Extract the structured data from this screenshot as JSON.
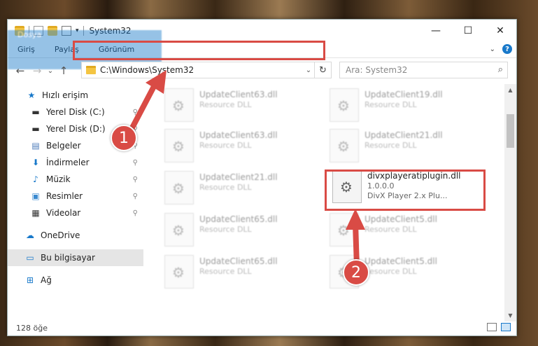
{
  "window": {
    "title": "System32",
    "controls": {
      "minimize": "—",
      "maximize": "☐",
      "close": "✕"
    }
  },
  "ribbon": {
    "tabs": [
      "Dosya",
      "Giriş",
      "Paylaş",
      "Görünüm"
    ]
  },
  "nav": {
    "address": "C:\\Windows\\System32",
    "search_placeholder": "Ara: System32"
  },
  "sidebar": {
    "items": [
      {
        "label": "Hızlı erişim",
        "icon": "star-icon",
        "pinned": false
      },
      {
        "label": "Yerel Disk (C:)",
        "icon": "drive-icon",
        "pinned": true
      },
      {
        "label": "Yerel Disk (D:)",
        "icon": "drive-icon",
        "pinned": true
      },
      {
        "label": "Belgeler",
        "icon": "documents-icon",
        "pinned": true
      },
      {
        "label": "İndirmeler",
        "icon": "download-icon",
        "pinned": true
      },
      {
        "label": "Müzik",
        "icon": "music-icon",
        "pinned": true
      },
      {
        "label": "Resimler",
        "icon": "pictures-icon",
        "pinned": true
      },
      {
        "label": "Videolar",
        "icon": "videos-icon",
        "pinned": true
      },
      {
        "label": "OneDrive",
        "icon": "cloud-icon",
        "pinned": false
      },
      {
        "label": "Bu bilgisayar",
        "icon": "computer-icon",
        "pinned": false,
        "selected": true
      },
      {
        "label": "Ağ",
        "icon": "network-icon",
        "pinned": false
      }
    ]
  },
  "files": [
    {
      "name": "UpdateClient63.dll",
      "sub1": "Resource DLL",
      "sub2": ""
    },
    {
      "name": "UpdateClient19.dll",
      "sub1": "Resource DLL",
      "sub2": ""
    },
    {
      "name": "UpdateClient63.dll",
      "sub1": "Resource DLL",
      "sub2": ""
    },
    {
      "name": "UpdateClient21.dll",
      "sub1": "Resource DLL",
      "sub2": ""
    },
    {
      "name": "UpdateClient21.dll",
      "sub1": "Resource DLL",
      "sub2": ""
    },
    {
      "name": "divxplayeratiplugin.dll",
      "sub1": "1.0.0.0",
      "sub2": "DivX Player 2.x Plu..."
    },
    {
      "name": "UpdateClient65.dll",
      "sub1": "Resource DLL",
      "sub2": ""
    },
    {
      "name": "UpdateClient5.dll",
      "sub1": "Resource DLL",
      "sub2": ""
    },
    {
      "name": "UpdateClient65.dll",
      "sub1": "Resource DLL",
      "sub2": ""
    },
    {
      "name": "UpdateClient5.dll",
      "sub1": "Resource DLL",
      "sub2": ""
    }
  ],
  "status": {
    "count": "128 öğe"
  },
  "callouts": {
    "step1": "1",
    "step2": "2"
  },
  "colors": {
    "accent": "#1979ca",
    "highlight": "#d94b45"
  }
}
